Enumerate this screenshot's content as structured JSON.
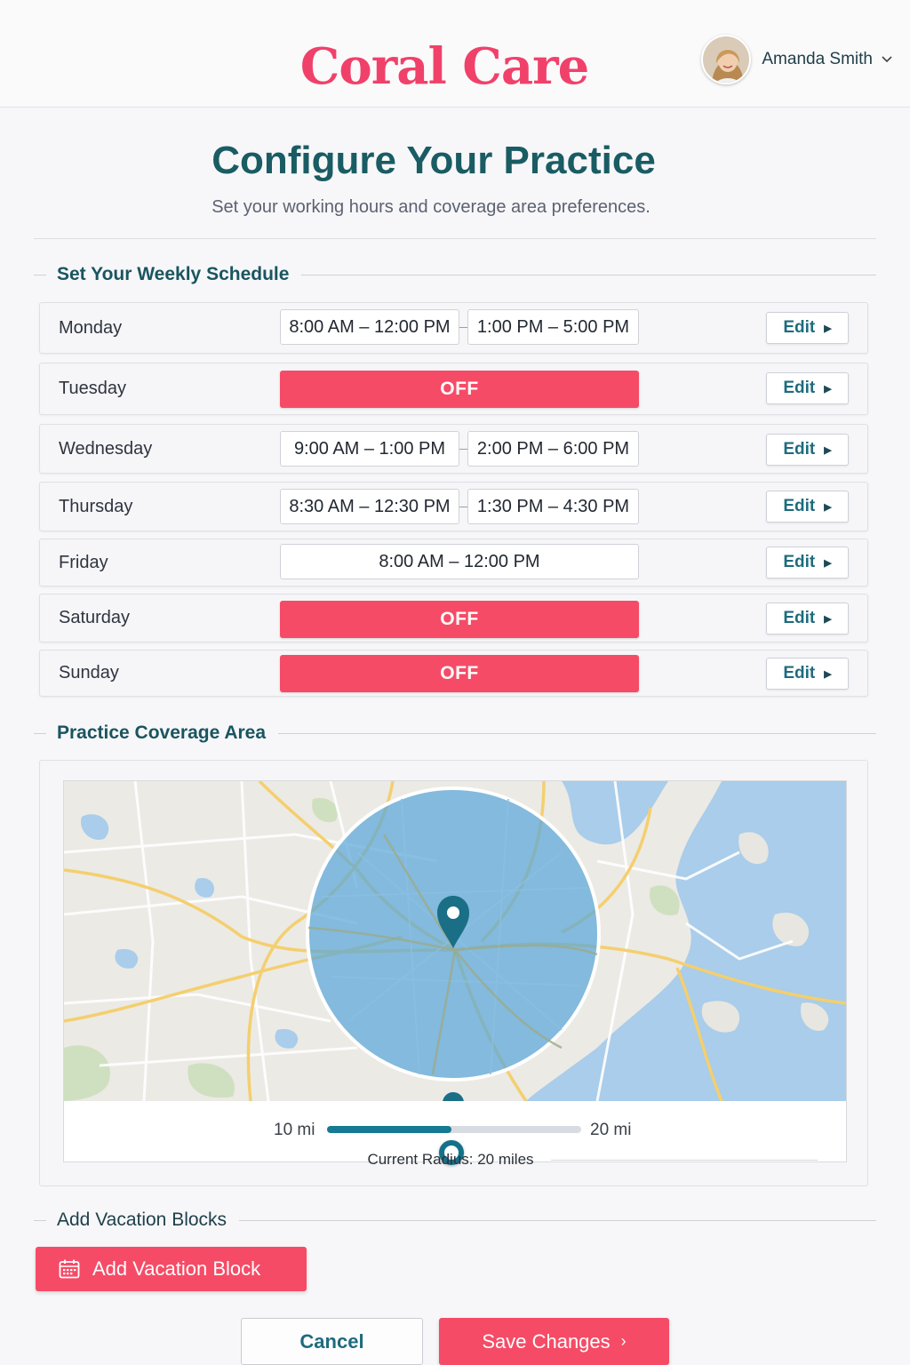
{
  "header": {
    "brand": "Coral Care",
    "user_name": "Amanda Smith"
  },
  "page": {
    "title": "Configure Your Practice",
    "subtitle": "Set your working hours and coverage area preferences."
  },
  "schedule": {
    "heading": "Set Your Weekly Schedule",
    "off_label": "OFF",
    "edit_label": "Edit",
    "days": [
      {
        "name": "Monday",
        "slot1": "8:00 AM – 12:00 PM",
        "slot2": "1:00 PM – 5:00 PM"
      },
      {
        "name": "Tuesday",
        "status": "OFF"
      },
      {
        "name": "Wednesday",
        "slot1": "9:00 AM – 1:00 PM",
        "slot2": "2:00 PM – 6:00 PM"
      },
      {
        "name": "Thursday",
        "slot1": "8:30 AM – 12:30 PM",
        "slot2": "1:30 PM – 4:30 PM"
      },
      {
        "name": "Friday",
        "slot": "8:00 AM – 12:00 PM"
      },
      {
        "name": "Saturday",
        "status": "OFF"
      },
      {
        "name": "Sunday",
        "status": "OFF"
      }
    ]
  },
  "coverage": {
    "heading": "Practice Coverage Area",
    "slider_min_label": "10 mi",
    "slider_max_label": "20 mi",
    "slider_value_fraction": 0.5,
    "current_radius_label": "Current Radius: 20 miles"
  },
  "vacation": {
    "heading": "Add Vacation Blocks",
    "button_label": "Add Vacation Block"
  },
  "actions": {
    "cancel_label": "Cancel",
    "save_label": "Save Changes"
  },
  "colors": {
    "brand": "#f0416a",
    "accent_teal": "#1a5c63",
    "off_red": "#f64b66",
    "coverage_blue": "#5aa7da"
  },
  "icons": [
    "chevron-down-icon",
    "chevron-right-icon",
    "map-pin-icon",
    "calendar-icon"
  ]
}
